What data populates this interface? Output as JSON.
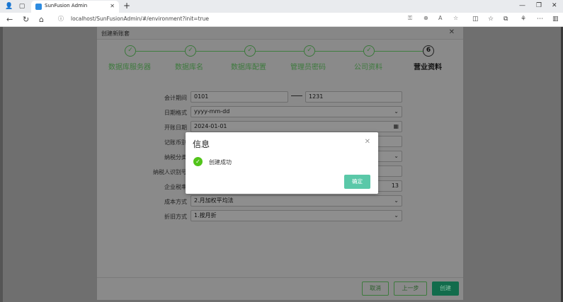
{
  "browser": {
    "tab_title": "SunFusion Admin",
    "url": "localhost/SunFusionAdmin/#/environment?init=true"
  },
  "dialog": {
    "title": "创建新账套",
    "steps": [
      {
        "label": "数据库服务器",
        "num": "✓"
      },
      {
        "label": "数据库名",
        "num": "✓"
      },
      {
        "label": "数据库配置",
        "num": "✓"
      },
      {
        "label": "管理员密码",
        "num": "✓"
      },
      {
        "label": "公司资料",
        "num": "✓"
      },
      {
        "label": "营业资料",
        "num": "6"
      }
    ],
    "form": {
      "period_label": "会计期间",
      "period_start": "0101",
      "period_end": "1231",
      "date_format_label": "日期格式",
      "date_format": "yyyy-mm-dd",
      "open_date_label": "开账日期",
      "open_date": "2024-01-01",
      "currency_label": "记账币别",
      "tax_class_label": "纳税分类",
      "tax_id_label": "纳税人识别号",
      "tax_rate_label": "企业税率",
      "tax_rate": "13",
      "cost_method_label": "成本方式",
      "cost_method": "2.月加权平均法",
      "depreciation_label": "折旧方式",
      "depreciation": "1.按月折"
    },
    "buttons": {
      "cancel": "取消",
      "prev": "上一步",
      "create": "创建"
    }
  },
  "modal": {
    "title": "信息",
    "message": "创建成功",
    "ok": "确定"
  }
}
